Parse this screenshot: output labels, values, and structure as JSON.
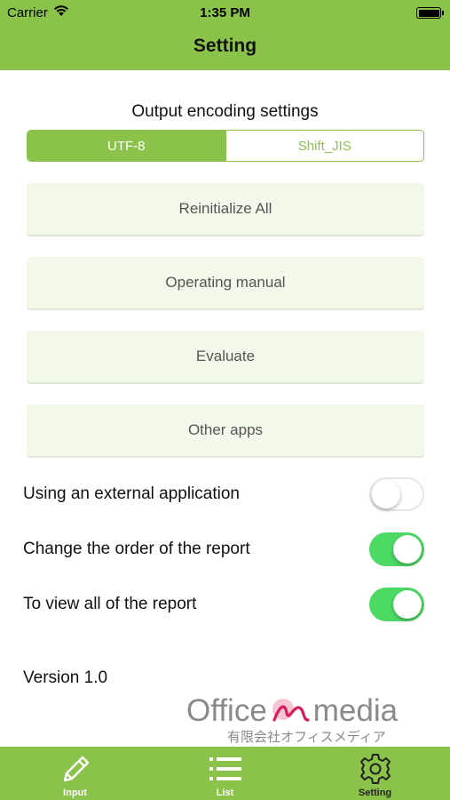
{
  "status_bar": {
    "carrier": "Carrier",
    "time": "1:35 PM"
  },
  "nav": {
    "title": "Setting"
  },
  "encoding": {
    "title": "Output encoding settings",
    "options": [
      "UTF-8",
      "Shift_JIS"
    ],
    "selected": "UTF-8"
  },
  "buttons": {
    "reinitialize": "Reinitialize All",
    "manual": "Operating manual",
    "evaluate": "Evaluate",
    "other_apps": "Other apps"
  },
  "toggles": [
    {
      "label": "Using an external application",
      "on": false
    },
    {
      "label": "Change the order of the report",
      "on": true
    },
    {
      "label": "To view all of the report",
      "on": true
    }
  ],
  "version": "Version 1.0",
  "logo": {
    "left": "Office",
    "right": "media",
    "sub": "有限会社オフィスメディア"
  },
  "tabs": [
    {
      "label": "Input",
      "icon": "pencil-icon",
      "selected": false
    },
    {
      "label": "List",
      "icon": "list-icon",
      "selected": false
    },
    {
      "label": "Setting",
      "icon": "gear-icon",
      "selected": true
    }
  ],
  "colors": {
    "accent": "#8bc34a",
    "toggle_on": "#4cd964",
    "button_bg": "#f2f9ea"
  }
}
